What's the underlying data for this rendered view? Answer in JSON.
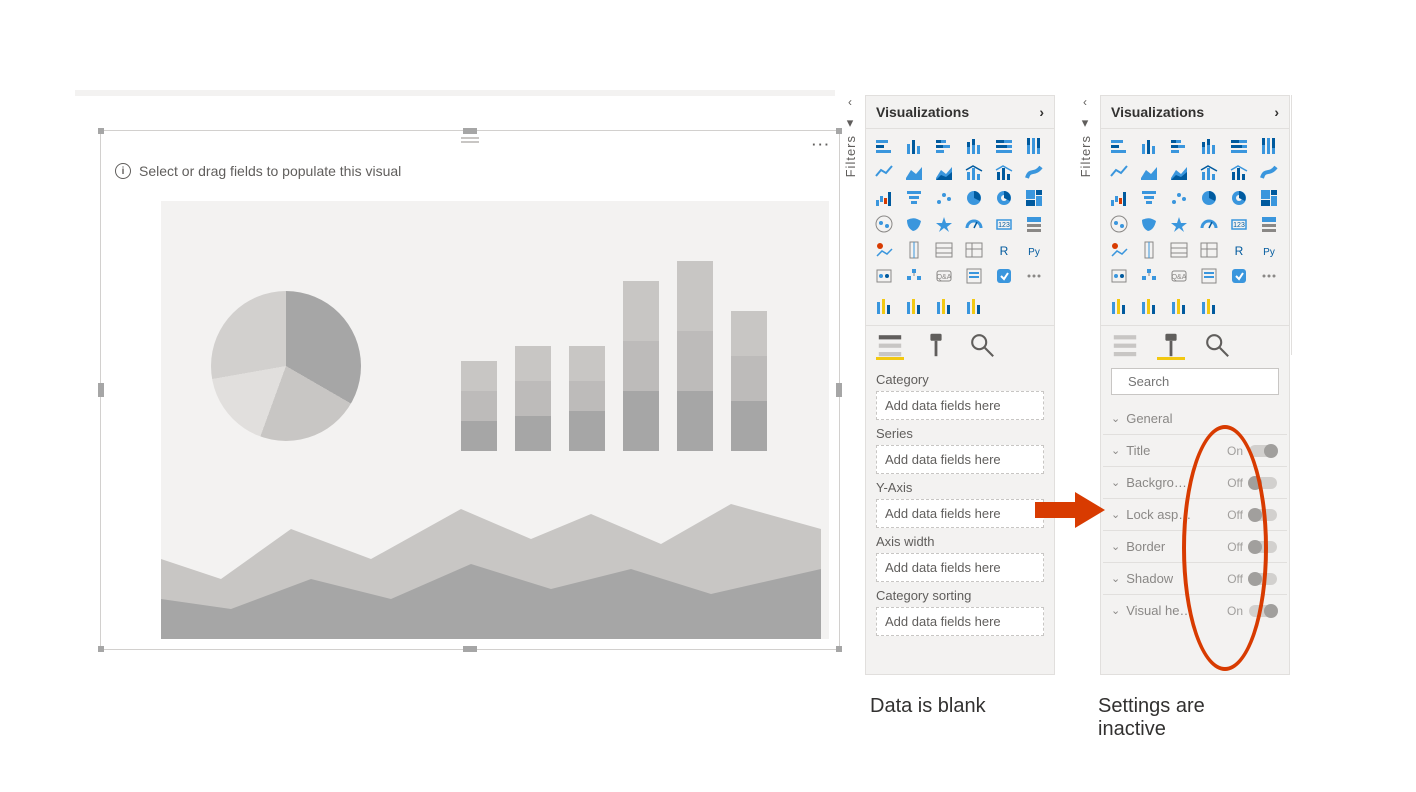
{
  "canvas": {
    "hint_text": "Select or drag fields to populate this visual"
  },
  "filters": {
    "label": "Filters"
  },
  "panel": {
    "title": "Visualizations"
  },
  "viz_icons": [
    "stacked-bar-chart",
    "stacked-column-chart",
    "clustered-bar-chart",
    "clustered-column-chart",
    "100-stacked-bar-chart",
    "100-stacked-column-chart",
    "line-chart",
    "area-chart",
    "stacked-area-chart",
    "line-stacked-column-chart",
    "line-clustered-column-chart",
    "ribbon-chart",
    "waterfall-chart",
    "funnel-chart",
    "scatter-chart",
    "pie-chart",
    "donut-chart",
    "treemap-chart",
    "map",
    "filled-map",
    "azure-map",
    "gauge",
    "card",
    "multi-row-card",
    "kpi",
    "slicer",
    "table",
    "matrix",
    "r-visual",
    "python-visual",
    "key-influencers",
    "decomposition-tree",
    "qa-visual",
    "paginated",
    "powerapps",
    "more-visuals"
  ],
  "custom_icons": [
    "custom-viz-1",
    "custom-viz-2",
    "custom-viz-3",
    "custom-viz-4"
  ],
  "pane_a": {
    "tabs": {
      "active": "fields"
    },
    "field_wells": [
      {
        "label": "Category",
        "placeholder": "Add data fields here"
      },
      {
        "label": "Series",
        "placeholder": "Add data fields here"
      },
      {
        "label": "Y-Axis",
        "placeholder": "Add data fields here"
      },
      {
        "label": "Axis width",
        "placeholder": "Add data fields here"
      },
      {
        "label": "Category sorting",
        "placeholder": "Add data fields here"
      }
    ]
  },
  "pane_b": {
    "tabs": {
      "active": "format"
    },
    "search_placeholder": "Search",
    "format_items": [
      {
        "label": "General",
        "toggle": null
      },
      {
        "label": "Title",
        "toggle": "On"
      },
      {
        "label": "Backgro…",
        "toggle": "Off"
      },
      {
        "label": "Lock asp…",
        "toggle": "Off"
      },
      {
        "label": "Border",
        "toggle": "Off"
      },
      {
        "label": "Shadow",
        "toggle": "Off"
      },
      {
        "label": "Visual he…",
        "toggle": "On"
      }
    ]
  },
  "annotations": {
    "data_blank": "Data is blank",
    "settings_inactive": "Settings are inactive"
  }
}
